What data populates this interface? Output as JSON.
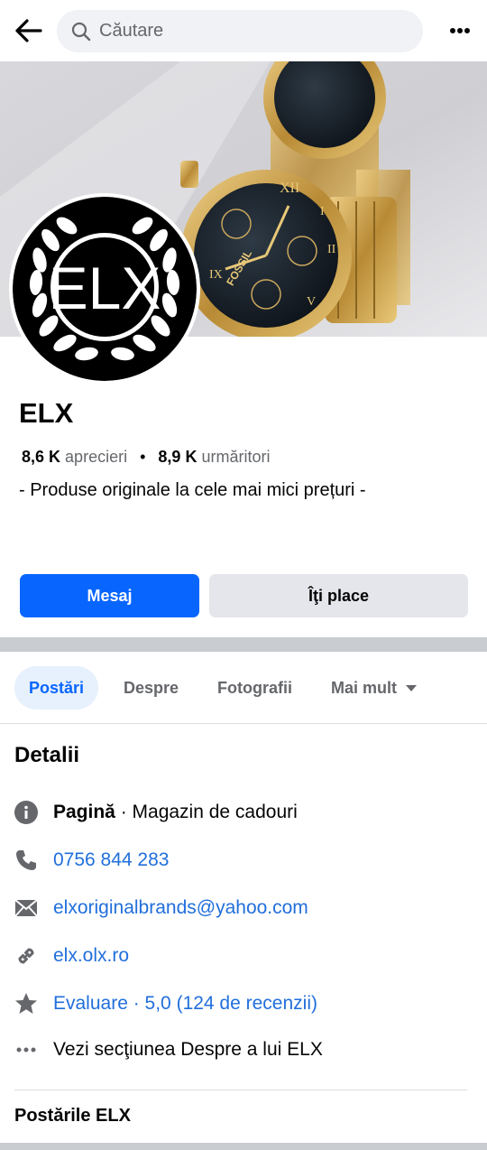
{
  "search": {
    "placeholder": "Căutare"
  },
  "page": {
    "name": "ELX",
    "likes_count": "8,6 K",
    "likes_label": "aprecieri",
    "followers_count": "8,9 K",
    "followers_label": "urmăritori",
    "tagline": "- Produse originale la cele mai mici prețuri -",
    "cover_brand_text": "FOSSIL",
    "avatar_logo_text": "ELX"
  },
  "actions": {
    "message": "Mesaj",
    "like": "Îţi place"
  },
  "tabs": [
    {
      "label": "Postări",
      "active": true
    },
    {
      "label": "Despre"
    },
    {
      "label": "Fotografii"
    },
    {
      "label": "Mai mult"
    }
  ],
  "details": {
    "title": "Detalii",
    "category_prefix": "Pagină",
    "category": " · Magazin de cadouri",
    "phone": "0756 844 283",
    "email": "elxoriginalbrands@yahoo.com",
    "website": "elx.olx.ro",
    "rating": "Evaluare · 5,0 (124 de recenzii)",
    "about": "Vezi secţiunea Despre a lui ELX"
  },
  "posts": {
    "title": "Postările ELX"
  },
  "colors": {
    "accent": "#0866ff",
    "link": "#216fdb",
    "muted": "#65676b"
  }
}
